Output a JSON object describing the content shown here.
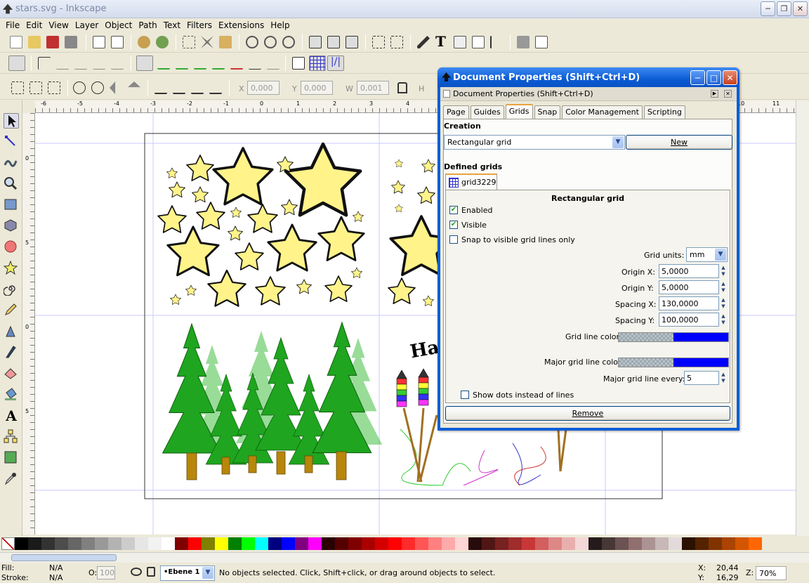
{
  "window": {
    "title": "stars.svg - Inkscape"
  },
  "menu": [
    "File",
    "Edit",
    "View",
    "Layer",
    "Object",
    "Path",
    "Text",
    "Filters",
    "Extensions",
    "Help"
  ],
  "toolbar3": {
    "x_label": "X",
    "x_value": "0,000",
    "y_label": "Y",
    "y_value": "0,000",
    "w_label": "W",
    "w_value": "0,001",
    "h_label": "H"
  },
  "ruler_h_labels": [
    "-6",
    "-5",
    "-4",
    "-3",
    "-2",
    "-1",
    "0",
    "1",
    "2",
    "3",
    "4",
    "5",
    "6",
    "7",
    "8",
    "9",
    "10",
    "11"
  ],
  "ruler_v_labels": [
    "0",
    "5",
    "0",
    "5"
  ],
  "dialog": {
    "title": "Document Properties (Shift+Ctrl+D)",
    "subtitle": "Document Properties (Shift+Ctrl+D)",
    "tabs": [
      "Page",
      "Guides",
      "Grids",
      "Snap",
      "Color Management",
      "Scripting"
    ],
    "active_tab": "Grids",
    "creation_label": "Creation",
    "grid_type": "Rectangular grid",
    "new_button": "New",
    "defined_grids_label": "Defined grids",
    "grid_tab": "grid3229",
    "grid_heading": "Rectangular grid",
    "enabled_label": "Enabled",
    "visible_label": "Visible",
    "snap_visible_label": "Snap to visible grid lines only",
    "grid_units_label": "Grid units:",
    "grid_units_value": "mm",
    "origin_x_label": "Origin X:",
    "origin_x_value": "5,0000",
    "origin_y_label": "Origin Y:",
    "origin_y_value": "5,0000",
    "spacing_x_label": "Spacing X:",
    "spacing_x_value": "130,0000",
    "spacing_y_label": "Spacing Y:",
    "spacing_y_value": "100,0000",
    "grid_line_color_label": "Grid line color:",
    "major_grid_line_color_label": "Major grid line color:",
    "major_every_label": "Major grid line every:",
    "major_every_value": "5",
    "show_dots_label": "Show dots instead of lines",
    "remove_button": "Remove",
    "grid_color": "#0000ff"
  },
  "canvas": {
    "happy_text": "Ha"
  },
  "palette": [
    "#000000",
    "#1a1a1a",
    "#333333",
    "#4d4d4d",
    "#666666",
    "#808080",
    "#999999",
    "#b3b3b3",
    "#cccccc",
    "#e6e6e6",
    "#f2f2f2",
    "#ffffff",
    "#800000",
    "#ff0000",
    "#808000",
    "#ffff00",
    "#008000",
    "#00ff00",
    "#00ffff",
    "#000080",
    "#0000ff",
    "#800080",
    "#ff00ff",
    "#2b0000",
    "#550000",
    "#800000",
    "#aa0000",
    "#d40000",
    "#ff0000",
    "#ff2a2a",
    "#ff5555",
    "#ff8080",
    "#ffaaaa",
    "#ffd5d5",
    "#280b0b",
    "#501616",
    "#782121",
    "#a02c2c",
    "#c83737",
    "#d35f5f",
    "#de8787",
    "#e9afaf",
    "#f4d7d7",
    "#241c1c",
    "#483737",
    "#6c5353",
    "#916f6f",
    "#ac9393",
    "#c8b7b7",
    "#e3dbdb",
    "#2b1100",
    "#552200",
    "#803300",
    "#aa4400",
    "#d45500",
    "#ff6600"
  ],
  "status": {
    "fill_label": "Fill:",
    "fill_value": "N/A",
    "stroke_label": "Stroke:",
    "stroke_value": "N/A",
    "opacity_label": "O:",
    "opacity_value": "100",
    "layer": "•Ebene 1",
    "message": "No objects selected. Click, Shift+click, or drag around objects to select.",
    "x_label": "X:",
    "x_value": "20,44",
    "y_label": "Y:",
    "y_value": "16,29",
    "zoom_label": "Z:",
    "zoom_value": "70%"
  }
}
